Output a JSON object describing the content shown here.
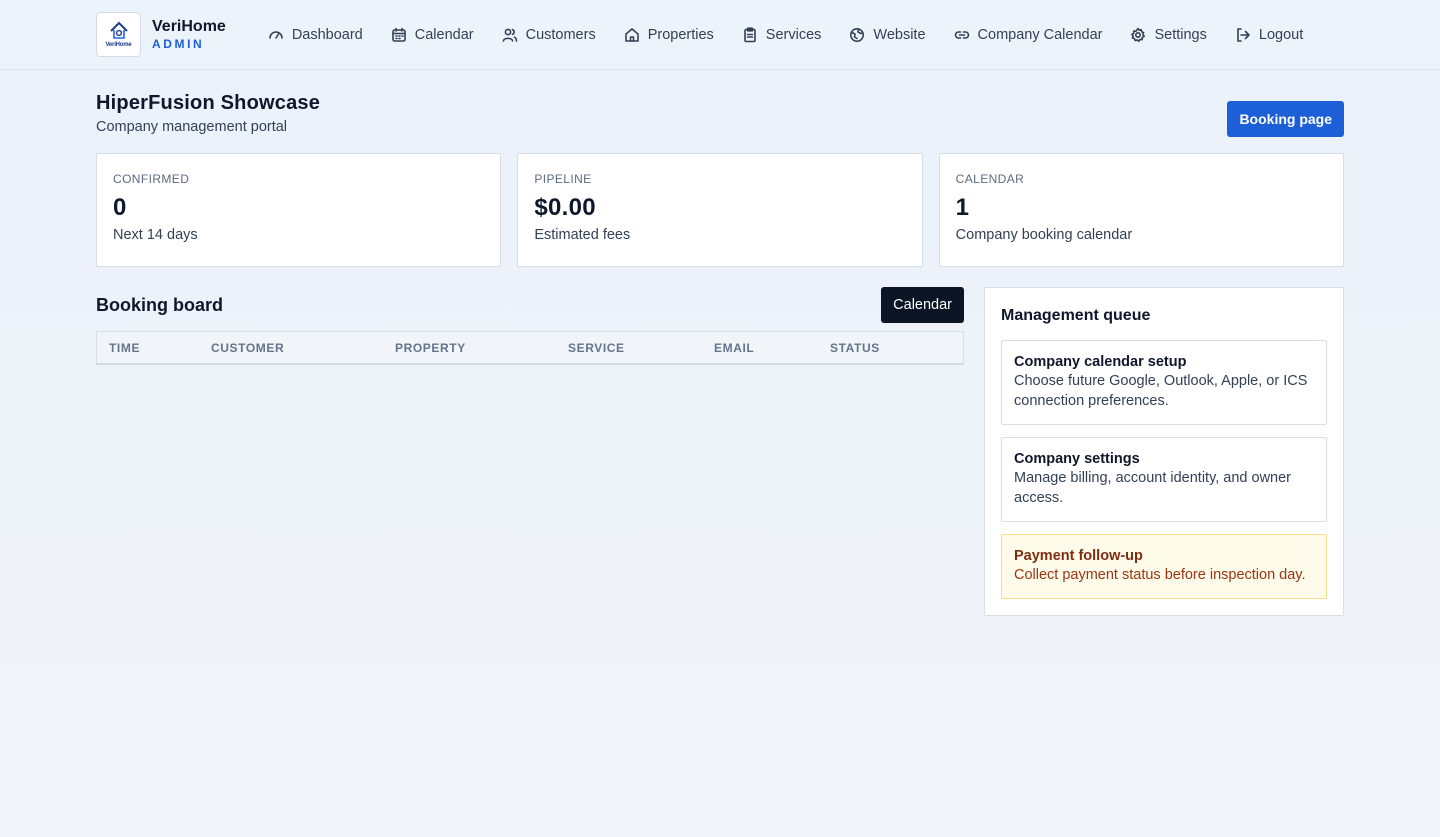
{
  "brand": {
    "logo_text": "VeriHome",
    "name": "VeriHome",
    "role": "ADMIN"
  },
  "nav": [
    {
      "label": "Dashboard",
      "icon": "dashboard-gauge-icon"
    },
    {
      "label": "Calendar",
      "icon": "calendar-icon"
    },
    {
      "label": "Customers",
      "icon": "users-icon"
    },
    {
      "label": "Properties",
      "icon": "home-icon"
    },
    {
      "label": "Services",
      "icon": "clipboard-icon"
    },
    {
      "label": "Website",
      "icon": "globe-icon"
    },
    {
      "label": "Company Calendar",
      "icon": "link-icon"
    },
    {
      "label": "Settings",
      "icon": "gear-icon"
    },
    {
      "label": "Logout",
      "icon": "logout-icon"
    }
  ],
  "page": {
    "title": "HiperFusion Showcase",
    "subtitle": "Company management portal",
    "booking_button": "Booking page"
  },
  "stats": [
    {
      "label": "Confirmed",
      "value": "0",
      "note": "Next 14 days"
    },
    {
      "label": "Pipeline",
      "value": "$0.00",
      "note": "Estimated fees"
    },
    {
      "label": "Calendar",
      "value": "1",
      "note": "Company booking calendar"
    }
  ],
  "board": {
    "title": "Booking board",
    "calendar_button": "Calendar",
    "columns": [
      "Time",
      "Customer",
      "Property",
      "Service",
      "Email",
      "Status"
    ],
    "rows": []
  },
  "queue": {
    "title": "Management queue",
    "items": [
      {
        "title": "Company calendar setup",
        "text": "Choose future Google, Outlook, Apple, or ICS connection preferences."
      },
      {
        "title": "Company settings",
        "text": "Manage billing, account identity, and owner access."
      },
      {
        "title": "Payment follow-up",
        "text": "Collect payment status before inspection day."
      }
    ]
  },
  "colors": {
    "accent": "#1d5fd6",
    "dark_button": "#0b1526",
    "warning_bg": "#fffbea",
    "warning_text": "#9a3412"
  }
}
